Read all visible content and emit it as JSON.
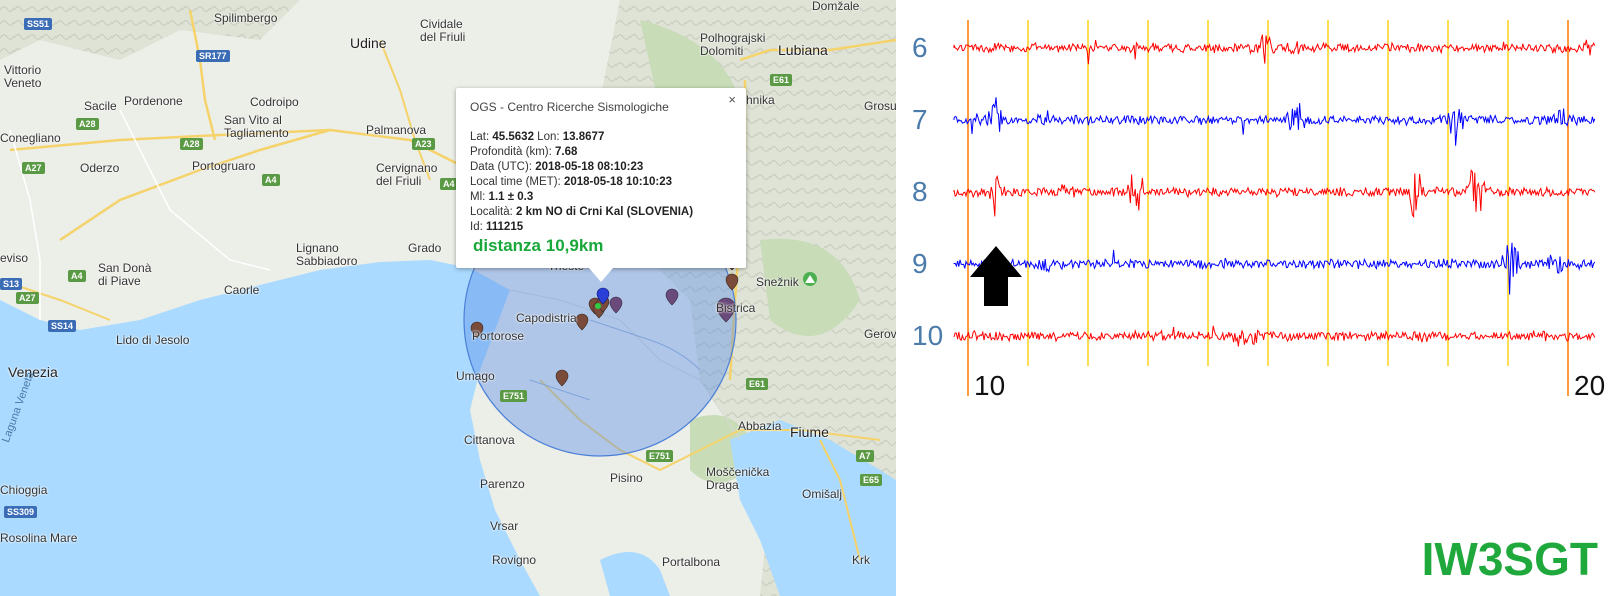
{
  "map": {
    "places": [
      {
        "id": "domzale",
        "label": "Domžale"
      },
      {
        "id": "spilimbergo",
        "label": "Spilimbergo"
      },
      {
        "id": "cividale",
        "label": "Cividale\ndel Friuli"
      },
      {
        "id": "polhograjski",
        "label": "Polhograjski\nDolomiti"
      },
      {
        "id": "lubiana",
        "label": "Lubiana"
      },
      {
        "id": "udine",
        "label": "Udine"
      },
      {
        "id": "vittorio",
        "label": "Vittorio\nVeneto"
      },
      {
        "id": "sacile",
        "label": "Sacile"
      },
      {
        "id": "pordenone",
        "label": "Pordenone"
      },
      {
        "id": "codroipo",
        "label": "Codroipo"
      },
      {
        "id": "sanvito",
        "label": "San Vito al\nTagliamento"
      },
      {
        "id": "palmanova",
        "label": "Palmanova"
      },
      {
        "id": "conegliano",
        "label": "Conegliano"
      },
      {
        "id": "cervignano",
        "label": "Cervignano\ndel Friuli"
      },
      {
        "id": "portogruaro",
        "label": "Portogruaro"
      },
      {
        "id": "oderzo",
        "label": "Oderzo"
      },
      {
        "id": "grado",
        "label": "Grado"
      },
      {
        "id": "lignano",
        "label": "Lignano\nSabbiadoro"
      },
      {
        "id": "treviso",
        "label": "eviso"
      },
      {
        "id": "sandona",
        "label": "San Donà\ndi Piave"
      },
      {
        "id": "caorle",
        "label": "Caorle"
      },
      {
        "id": "trieste",
        "label": "Trieste"
      },
      {
        "id": "capodistria",
        "label": "Capodistria"
      },
      {
        "id": "portorose",
        "label": "Portorose"
      },
      {
        "id": "sneznik",
        "label": "Snežnik"
      },
      {
        "id": "ilirska",
        "label": "Bistrica"
      },
      {
        "id": "lidojesolo",
        "label": "Lido di Jesolo"
      },
      {
        "id": "venezia",
        "label": "Venezia"
      },
      {
        "id": "umago",
        "label": "Umago"
      },
      {
        "id": "lagunaveneta",
        "label": "Laguna Veneta"
      },
      {
        "id": "abbazia",
        "label": "Abbazia"
      },
      {
        "id": "fiume",
        "label": "Fiume"
      },
      {
        "id": "cittanova",
        "label": "Cittanova"
      },
      {
        "id": "chioggia",
        "label": "Chioggia"
      },
      {
        "id": "parenzo",
        "label": "Parenzo"
      },
      {
        "id": "pisino",
        "label": "Pisino"
      },
      {
        "id": "moscenicka",
        "label": "Moščenička\nDraga"
      },
      {
        "id": "omisalj",
        "label": "Omišalj"
      },
      {
        "id": "rosolina",
        "label": "Rosolina Mare"
      },
      {
        "id": "vrsar",
        "label": "Vrsar"
      },
      {
        "id": "krk",
        "label": "Krk"
      },
      {
        "id": "rovigno",
        "label": "Rovigno"
      },
      {
        "id": "portalbona",
        "label": "Portalbona"
      },
      {
        "id": "grosuplje",
        "label": "Grosu"
      },
      {
        "id": "ribnica",
        "label": "hnika"
      },
      {
        "id": "gerovo",
        "label": "Gerovo"
      }
    ],
    "roads": [
      {
        "id": "ss51",
        "label": "SS51",
        "color": "#3b6cb6"
      },
      {
        "id": "sr177",
        "label": "SR177",
        "color": "#3b6cb6"
      },
      {
        "id": "a28a",
        "label": "A28",
        "color": "#5b9a44"
      },
      {
        "id": "a28b",
        "label": "A28",
        "color": "#5b9a44"
      },
      {
        "id": "a23",
        "label": "A23",
        "color": "#5b9a44"
      },
      {
        "id": "a27a",
        "label": "A27",
        "color": "#5b9a44"
      },
      {
        "id": "a4a",
        "label": "A4",
        "color": "#5b9a44"
      },
      {
        "id": "a4b",
        "label": "A4",
        "color": "#5b9a44"
      },
      {
        "id": "a4c",
        "label": "A4",
        "color": "#5b9a44"
      },
      {
        "id": "ss13",
        "label": "S13",
        "color": "#3b6cb6"
      },
      {
        "id": "a27b",
        "label": "A27",
        "color": "#5b9a44"
      },
      {
        "id": "ss14",
        "label": "SS14",
        "color": "#3b6cb6"
      },
      {
        "id": "e61a",
        "label": "E61",
        "color": "#5b9a44"
      },
      {
        "id": "e751a",
        "label": "E751",
        "color": "#5b9a44"
      },
      {
        "id": "e61b",
        "label": "E61",
        "color": "#5b9a44"
      },
      {
        "id": "e751b",
        "label": "E751",
        "color": "#5b9a44"
      },
      {
        "id": "a7",
        "label": "A7",
        "color": "#5b9a44"
      },
      {
        "id": "e65",
        "label": "E65",
        "color": "#5b9a44"
      },
      {
        "id": "ss309",
        "label": "SS309",
        "color": "#3b6cb6"
      }
    ],
    "radius_circle_color": "#5b8fe8",
    "marker_colors": [
      "#7a4a3a",
      "#6a4a7a",
      "#2a3fd8"
    ]
  },
  "popup": {
    "title": "OGS - Centro Ricerche Sismologiche",
    "close_glyph": "×",
    "lat_label": "Lat:",
    "lat": "45.5632",
    "lon_label": "Lon:",
    "lon": "13.8677",
    "depth_label": "Profondità (km):",
    "depth": "7.68",
    "date_label": "Data (UTC):",
    "date": "2018-05-18 08:10:23",
    "local_label": "Local time (MET):",
    "local": "2018-05-18 10:10:23",
    "ml_label": "Ml:",
    "ml": "1.1 ± 0.3",
    "place_label": "Località:",
    "place": "2 km NO di Crni Kal (SLOVENIA)",
    "id_label": "Id:",
    "id": "111215",
    "distance": "distanza 10,9km"
  },
  "seismogram": {
    "hour_labels": [
      "6",
      "7",
      "8",
      "9",
      "10"
    ],
    "trace_colors": [
      "#ff0000",
      "#0000ff",
      "#ff0000",
      "#0000ff",
      "#ff0000"
    ],
    "minute_start_label": "10",
    "minute_end_label": "20",
    "arrow_icon": "up-arrow",
    "grid_colors": {
      "orange": "#ff7a00",
      "yellow": "#ffd21a"
    },
    "callsign": "IW3SGT"
  }
}
